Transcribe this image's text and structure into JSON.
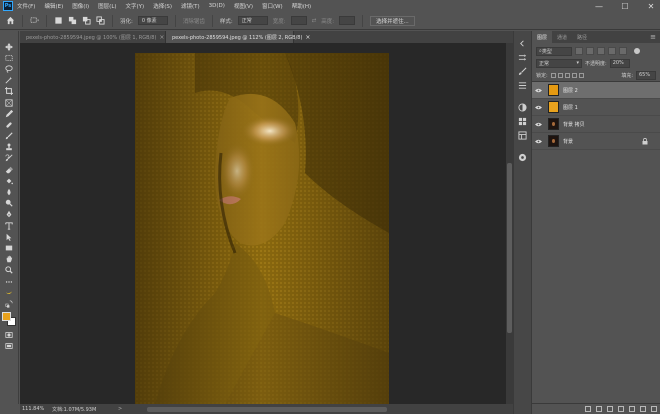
{
  "app": {
    "logo": "Ps"
  },
  "menu": [
    "文件(F)",
    "编辑(E)",
    "图像(I)",
    "图层(L)",
    "文字(Y)",
    "选择(S)",
    "滤镜(T)",
    "3D(D)",
    "视图(V)",
    "窗口(W)",
    "帮助(H)"
  ],
  "window_controls": {
    "minimize": "—",
    "maximize": "☐",
    "close": "✕"
  },
  "options": {
    "feather_label": "羽化:",
    "feather_value": "0 像素",
    "antialias_label": "消除锯齿",
    "style_label": "样式:",
    "style_value": "正常",
    "width_label": "宽度:",
    "height_label": "高度:",
    "select_mask_button": "选择并遮住..."
  },
  "tabs": [
    {
      "label": "pexels-photo-2859594.jpeg @ 100% (图层 1, RGB/8)",
      "close": "×"
    },
    {
      "label": "pexels-photo-2859594.jpeg @ 112% (图层 2, RGB/8)",
      "close": "×"
    }
  ],
  "status": {
    "zoom": "111.84%",
    "doc": "文档:1.07M/5.93M",
    "arrow": ">"
  },
  "layers_panel": {
    "tabs": [
      "图层",
      "通道",
      "路径"
    ],
    "filter_label": "类型",
    "blend_mode": "正常",
    "opacity_label": "不透明度:",
    "opacity_value": "20%",
    "lock_label": "锁定:",
    "fill_label": "填充:",
    "fill_value": "65%",
    "layers": [
      {
        "name": "图层 2",
        "thumb": "orange",
        "selected": true
      },
      {
        "name": "图层 1",
        "thumb": "orange2",
        "selected": false
      },
      {
        "name": "背景 拷贝",
        "thumb": "photo",
        "selected": false
      },
      {
        "name": "背景",
        "thumb": "photo",
        "selected": false,
        "locked": true
      }
    ]
  },
  "colors": {
    "foreground": "#e8a11c",
    "background": "#ffffff",
    "canvas_tint": "#8c6a0e"
  }
}
